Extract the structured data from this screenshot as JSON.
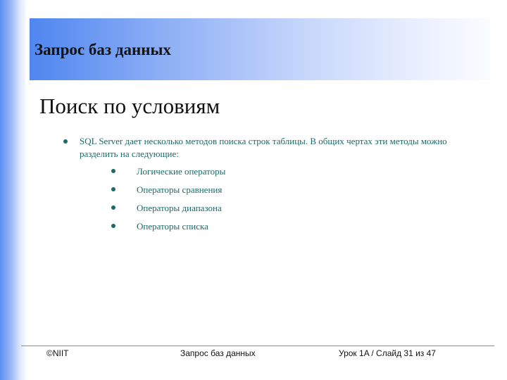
{
  "header": {
    "title": "Запрос баз данных"
  },
  "slide": {
    "title": "Поиск по условиям",
    "intro": "SQL Server дает несколько методов поиска строк таблицы. В общих чертах эти методы можно разделить на следующие:",
    "items": [
      "Логические операторы",
      "Операторы сравнения",
      "Операторы диапазона",
      "Операторы списка"
    ]
  },
  "footer": {
    "copyright": "©NIIT",
    "course": "Запрос баз данных",
    "position": "Урок 1A / Слайд 31 из 47"
  },
  "colors": {
    "accent": "#4f86f0",
    "text_teal": "#1a6a68"
  }
}
